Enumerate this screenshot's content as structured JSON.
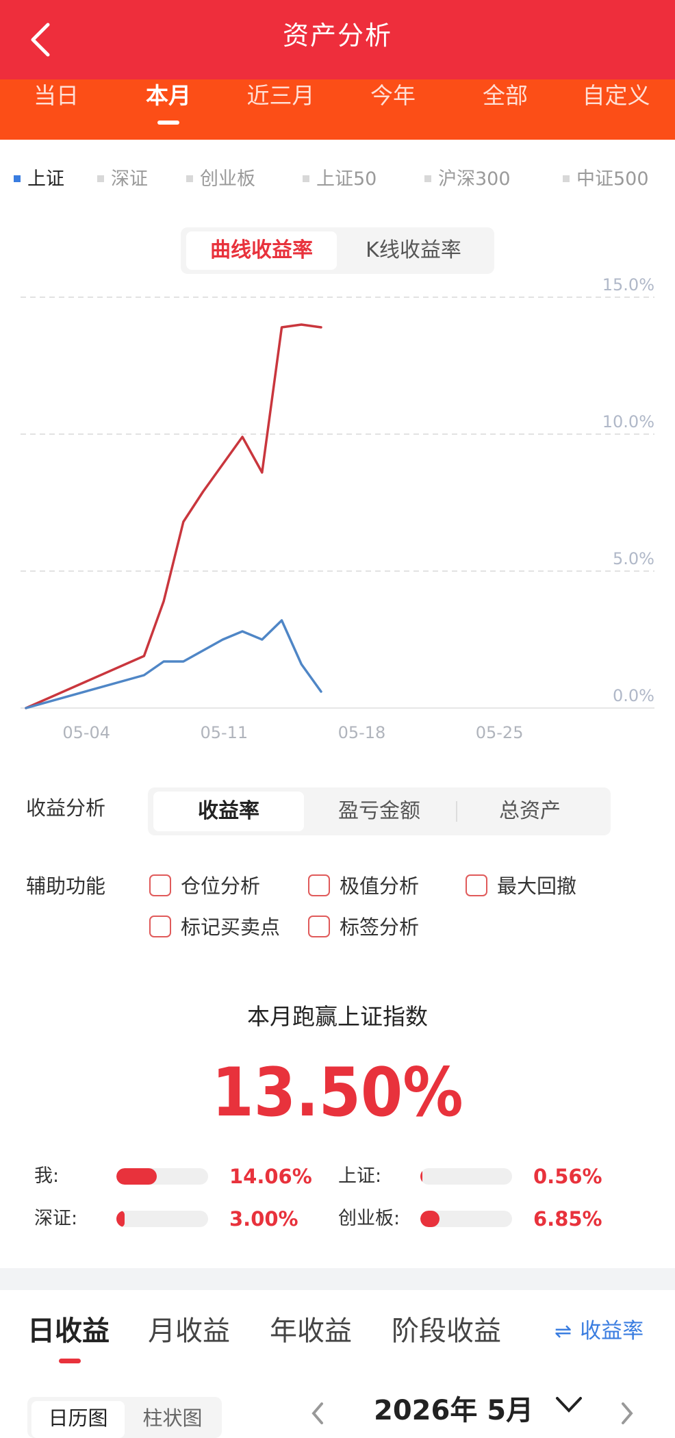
{
  "header": {
    "title": "资产分析",
    "back_icon": "chevron-left-icon"
  },
  "period_tabs": [
    {
      "label": "当日",
      "active": false
    },
    {
      "label": "本月",
      "active": true
    },
    {
      "label": "近三月",
      "active": false
    },
    {
      "label": "今年",
      "active": false
    },
    {
      "label": "全部",
      "active": false
    },
    {
      "label": "自定义",
      "active": false
    }
  ],
  "index_selector": [
    {
      "label": "上证",
      "active": true
    },
    {
      "label": "深证",
      "active": false
    },
    {
      "label": "创业板",
      "active": false
    },
    {
      "label": "上证50",
      "active": false
    },
    {
      "label": "沪深300",
      "active": false
    },
    {
      "label": "中证500",
      "active": false
    }
  ],
  "chart_toggle": {
    "curve_label": "曲线收益率",
    "kline_label": "K线收益率",
    "active": "curve"
  },
  "colors": {
    "header_red": "#ee2e3c",
    "tab_orange": "#fc4e17",
    "accent_red": "#e8323c",
    "line_red": "#c9363d",
    "line_blue": "#4f86c6",
    "link_blue": "#3a7de0"
  },
  "chart_data": {
    "type": "line",
    "x_ticks": [
      "05-04",
      "05-11",
      "05-18",
      "05-25"
    ],
    "y_ticks": [
      "15.0%",
      "10.0%",
      "5.0%",
      "0.0%"
    ],
    "ylim": [
      0,
      15
    ],
    "xlim": [
      0,
      30
    ],
    "grid": true,
    "series": [
      {
        "name": "我",
        "color": "#c9363d",
        "x": [
          0,
          6,
          7,
          8,
          9,
          10,
          11,
          12,
          13,
          14,
          15
        ],
        "y": [
          0,
          1.9,
          3.9,
          6.8,
          7.9,
          8.9,
          9.9,
          8.6,
          13.9,
          14.0,
          13.9
        ]
      },
      {
        "name": "上证",
        "color": "#4f86c6",
        "x": [
          0,
          6,
          7,
          8,
          9,
          10,
          11,
          12,
          13,
          14,
          15
        ],
        "y": [
          0,
          1.2,
          1.7,
          1.7,
          2.1,
          2.5,
          2.8,
          2.5,
          3.2,
          1.6,
          0.6
        ]
      }
    ]
  },
  "profit_analysis": {
    "label": "收益分析",
    "options": [
      "收益率",
      "盈亏金额",
      "总资产"
    ],
    "active": "收益率"
  },
  "aux_functions": {
    "label": "辅助功能",
    "options": [
      "仓位分析",
      "极值分析",
      "最大回撤",
      "标记买卖点",
      "标签分析"
    ]
  },
  "beat": {
    "label": "本月跑赢上证指数",
    "value": "13.50%"
  },
  "comparisons": [
    {
      "label": "我:",
      "value": "14.06%",
      "ratio": 0.4406
    },
    {
      "label": "上证:",
      "value": "0.56%",
      "ratio": 0.02
    },
    {
      "label": "深证:",
      "value": "3.00%",
      "ratio": 0.09
    },
    {
      "label": "创业板:",
      "value": "6.85%",
      "ratio": 0.21
    }
  ],
  "bottom_tabs": {
    "tabs": [
      "日收益",
      "月收益",
      "年收益",
      "阶段收益"
    ],
    "active": "日收益",
    "rate_toggle": "收益率",
    "calendar_views": [
      "日历图",
      "柱状图"
    ],
    "month_label": "2026年 5月"
  }
}
